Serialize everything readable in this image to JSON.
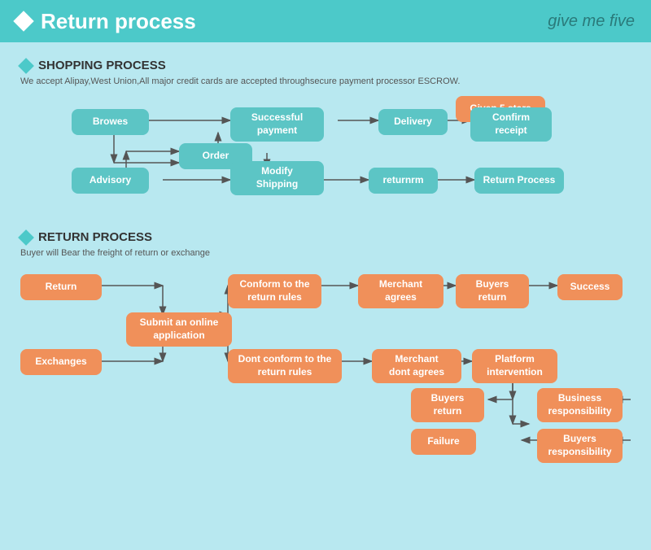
{
  "header": {
    "title": "Return process",
    "logo": "give me five"
  },
  "shopping": {
    "title": "SHOPPING PROCESS",
    "subtitle": "We accept Alipay,West Union,All major credit cards are accepted throughsecure payment processor ESCROW.",
    "boxes": {
      "browes": "Browes",
      "order": "Order",
      "advisory": "Advisory",
      "modify_shipping": "Modify\nShipping",
      "successful_payment": "Successful\npayment",
      "delivery": "Delivery",
      "confirm_receipt": "Confirm\nreceipt",
      "given_5_stars": "Given 5 stars",
      "returnrm": "returnrm",
      "return_process": "Return Process"
    }
  },
  "return": {
    "title": "RETURN PROCESS",
    "subtitle": "Buyer will Bear the freight of return or exchange",
    "boxes": {
      "return": "Return",
      "exchanges": "Exchanges",
      "submit_online": "Submit an online\napplication",
      "conform_rules": "Conform to the\nreturn rules",
      "dont_conform_rules": "Dont conform to the\nreturn rules",
      "merchant_agrees": "Merchant\nagrees",
      "merchant_dont_agrees": "Merchant\ndont agrees",
      "buyers_return_1": "Buyers\nreturn",
      "buyers_return_2": "Buyers\nreturn",
      "platform_intervention": "Platform\nintervention",
      "success": "Success",
      "business_responsibility": "Business\nresponsibility",
      "buyers_responsibility": "Buyers\nresponsibility",
      "failure": "Failure"
    }
  }
}
